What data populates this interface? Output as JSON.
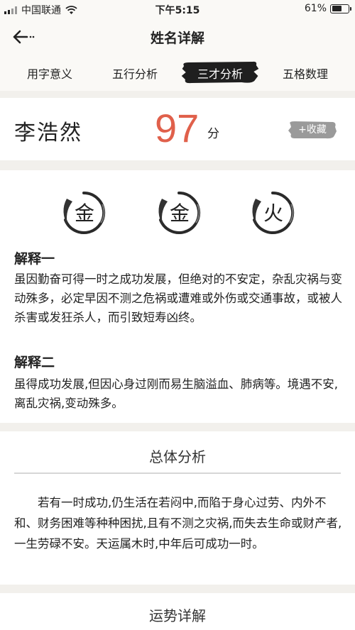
{
  "status_bar": {
    "carrier": "中国联通",
    "time": "下午5:15",
    "battery_text": "61%",
    "battery_level": 0.61,
    "icons": [
      "signal-icon",
      "wifi-icon",
      "battery-icon"
    ]
  },
  "nav": {
    "title": "姓名详解",
    "back_icon": "back-arrow-icon"
  },
  "tabs": [
    {
      "label": "用字意义",
      "active": false
    },
    {
      "label": "五行分析",
      "active": false
    },
    {
      "label": "三才分析",
      "active": true
    },
    {
      "label": "五格数理",
      "active": false
    }
  ],
  "name_card": {
    "full_name": "李浩然",
    "score": "97",
    "score_unit": "分",
    "favorite_label": "+收藏"
  },
  "sancai": {
    "elements": [
      "金",
      "金",
      "火"
    ],
    "explanation1_title": "解释一",
    "explanation1_text": "虽因勤奋可得一时之成功发展，但绝对的不安定，杂乱灾祸与变动殊多，必定早因不测之危祸或遭难或外伤或交通事故，或被人杀害或发狂杀人，而引致短寿凶终。",
    "explanation2_title": "解释二",
    "explanation2_text": "虽得成功发展,但因心身过刚而易生脑溢血、肺病等。境遇不安,离乱灾祸,变动殊多。"
  },
  "overall": {
    "title": "总体分析",
    "text": "若有一时成功,仍生活在若闷中,而陷于身心过劳、内外不和、财务困难等种种困扰,且有不测之灾祸,而失去生命或财产者,一生劳碌不安。天运属木时,中年后可成功一时。"
  },
  "fortune": {
    "title": "运势详解"
  },
  "colors": {
    "score": "#e0604b",
    "brush": "#1f1f1f",
    "background": "#f2f0ec"
  }
}
